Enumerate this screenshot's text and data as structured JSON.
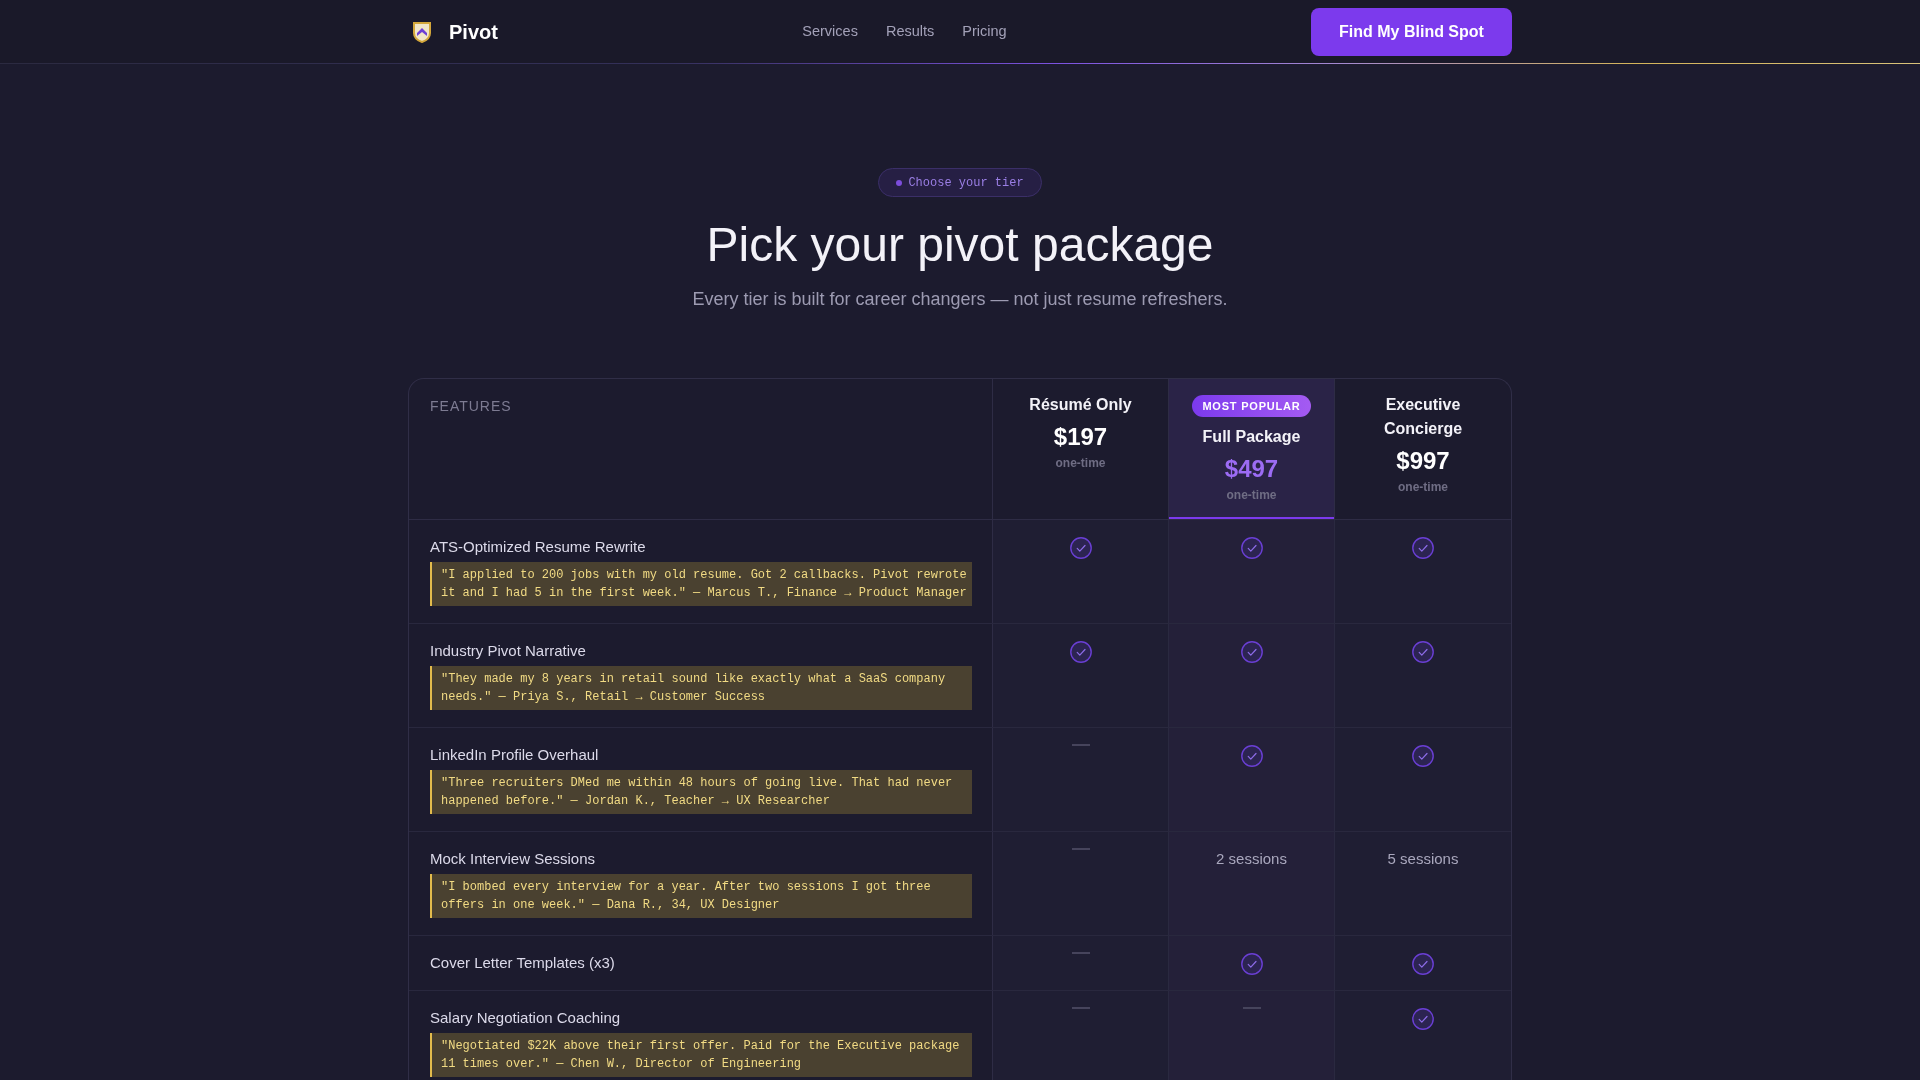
{
  "nav": {
    "brand": "Pivot",
    "links": [
      "Services",
      "Results",
      "Pricing"
    ],
    "cta": "Find My Blind Spot"
  },
  "hero": {
    "eyebrow": "Choose your tier",
    "title": "Pick your pivot package",
    "subtitle": "Every tier is built for career changers — not just resume refreshers."
  },
  "table": {
    "features_heading": "FEATURES",
    "tiers": [
      {
        "name": "Résumé Only",
        "price": "$197",
        "billing": "one-time",
        "highlighted": false
      },
      {
        "badge": "MOST POPULAR",
        "name": "Full Package",
        "price": "$497",
        "billing": "one-time",
        "highlighted": true
      },
      {
        "name": "Executive Concierge",
        "price": "$997",
        "billing": "one-time",
        "highlighted": false
      }
    ],
    "rows": [
      {
        "feature": "ATS-Optimized Resume Rewrite",
        "quote": "\"I applied to 200 jobs with my old resume. Got 2 callbacks. Pivot rewrote it and I had 5 in the first week.\" — Marcus T., Finance → Product Manager",
        "cells": [
          {
            "kind": "check"
          },
          {
            "kind": "check"
          },
          {
            "kind": "check"
          }
        ]
      },
      {
        "feature": "Industry Pivot Narrative",
        "quote": "\"They made my 8 years in retail sound like exactly what a SaaS company needs.\" — Priya S., Retail → Customer Success",
        "cells": [
          {
            "kind": "check"
          },
          {
            "kind": "check"
          },
          {
            "kind": "check"
          }
        ]
      },
      {
        "feature": "LinkedIn Profile Overhaul",
        "quote": "\"Three recruiters DMed me within 48 hours of going live. That had never happened before.\" — Jordan K., Teacher → UX Researcher",
        "cells": [
          {
            "kind": "dash"
          },
          {
            "kind": "check"
          },
          {
            "kind": "check"
          }
        ]
      },
      {
        "feature": "Mock Interview Sessions",
        "quote": "\"I bombed every interview for a year. After two sessions I got three offers in one week.\" — Dana R., 34, UX Designer",
        "cells": [
          {
            "kind": "dash"
          },
          {
            "kind": "text",
            "text": "2 sessions"
          },
          {
            "kind": "text",
            "text": "5 sessions"
          }
        ]
      },
      {
        "feature": "Cover Letter Templates (x3)",
        "cells": [
          {
            "kind": "dash"
          },
          {
            "kind": "check"
          },
          {
            "kind": "check"
          }
        ]
      },
      {
        "feature": "Salary Negotiation Coaching",
        "quote": "\"Negotiated $22K above their first offer. Paid for the Executive package 11 times over.\" — Chen W., Director of Engineering",
        "cells": [
          {
            "kind": "dash"
          },
          {
            "kind": "dash"
          },
          {
            "kind": "check"
          }
        ]
      }
    ]
  }
}
